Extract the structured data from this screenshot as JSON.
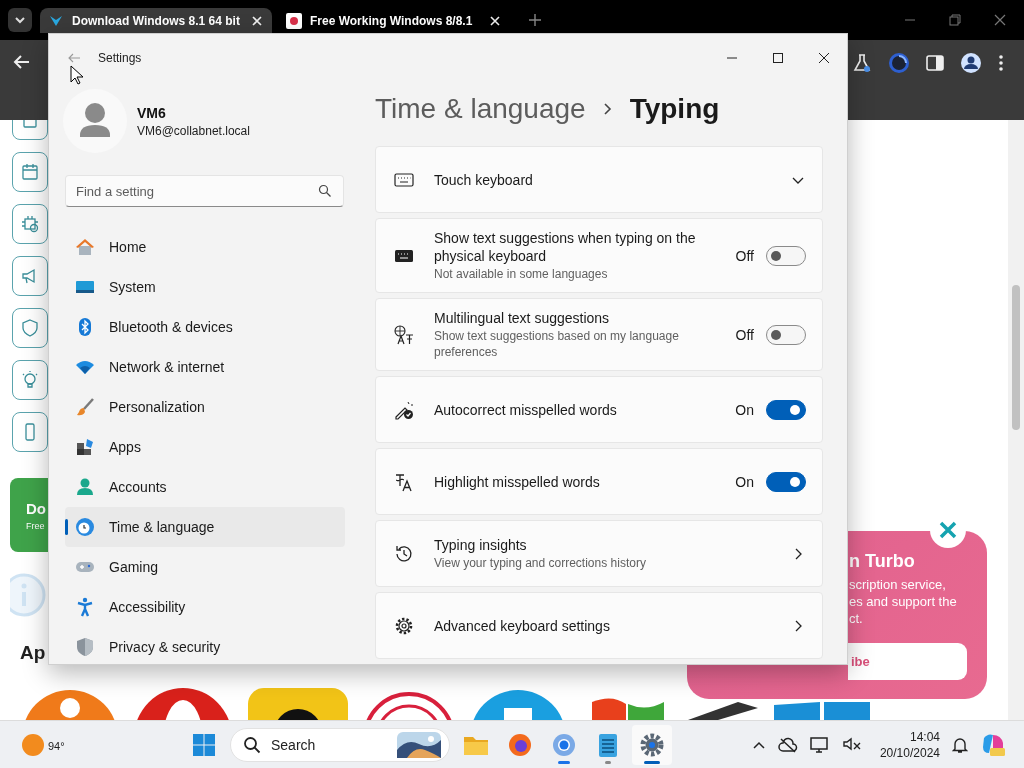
{
  "browser": {
    "tabs": [
      {
        "title": "Download Windows 8.1 64 bit",
        "selected": true
      },
      {
        "title": "Free Working Windows 8/8.1",
        "selected": false
      }
    ]
  },
  "page": {
    "promo_card": {
      "title": "Do",
      "subtitle": "Free"
    },
    "section_heading": "Ap",
    "popup": {
      "title": "n Turbo",
      "lines": [
        "scription service,",
        "es and support the",
        "ct."
      ],
      "button": "ibe"
    }
  },
  "settings": {
    "title": "Settings",
    "user": {
      "name": "VM6",
      "email": "VM6@collabnet.local"
    },
    "search": {
      "placeholder": "Find a setting"
    },
    "nav": [
      {
        "label": "Home",
        "selected": false
      },
      {
        "label": "System",
        "selected": false
      },
      {
        "label": "Bluetooth & devices",
        "selected": false
      },
      {
        "label": "Network & internet",
        "selected": false
      },
      {
        "label": "Personalization",
        "selected": false
      },
      {
        "label": "Apps",
        "selected": false
      },
      {
        "label": "Accounts",
        "selected": false
      },
      {
        "label": "Time & language",
        "selected": true
      },
      {
        "label": "Gaming",
        "selected": false
      },
      {
        "label": "Accessibility",
        "selected": false
      },
      {
        "label": "Privacy & security",
        "selected": false
      }
    ],
    "breadcrumb": {
      "parent": "Time & language",
      "current": "Typing"
    },
    "rows": [
      {
        "kind": "expander",
        "title": "Touch keyboard",
        "expanded": false
      },
      {
        "kind": "toggle",
        "title": "Show text suggestions when typing on the physical keyboard",
        "description": "Not available in some languages",
        "on": false,
        "state_label": "Off"
      },
      {
        "kind": "toggle",
        "title": "Multilingual text suggestions",
        "description": "Show text suggestions based on my language preferences",
        "on": false,
        "state_label": "Off"
      },
      {
        "kind": "toggle",
        "title": "Autocorrect misspelled words",
        "on": true,
        "state_label": "On"
      },
      {
        "kind": "toggle",
        "title": "Highlight misspelled words",
        "on": true,
        "state_label": "On"
      },
      {
        "kind": "link",
        "title": "Typing insights",
        "description": "View your typing and corrections history"
      },
      {
        "kind": "link",
        "title": "Advanced keyboard settings"
      }
    ]
  },
  "taskbar": {
    "weather": "94°",
    "search": {
      "label": "Search"
    },
    "time": "14:04",
    "date": "20/10/2024"
  }
}
